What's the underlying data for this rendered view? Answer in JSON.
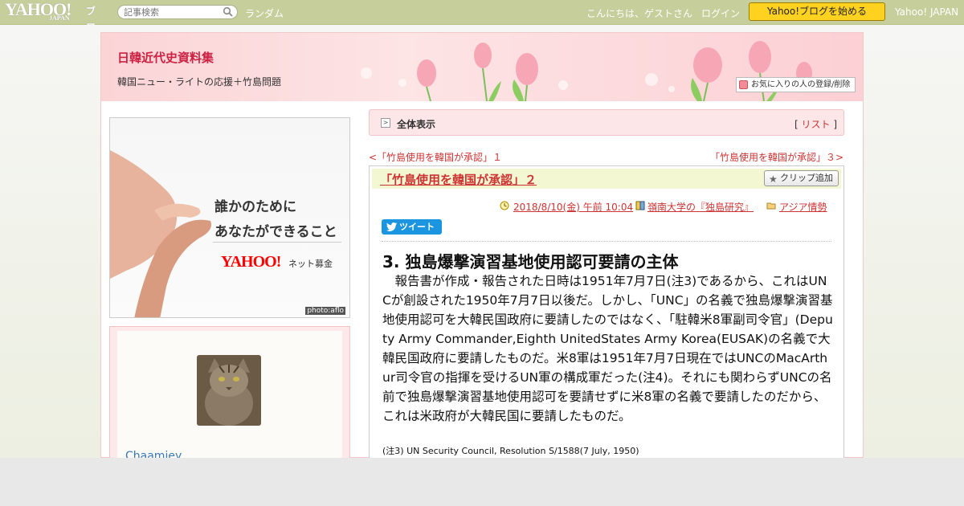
{
  "topbar": {
    "logo": "YAHOO!",
    "logo_sub": "JAPAN",
    "logo_blog": "ブログ",
    "search_placeholder": "記事検索",
    "random": "ランダム",
    "greeting": "こんにちは、ゲストさん",
    "login": "ログイン",
    "start_button": "Yahoo!ブログを始める",
    "yahoo_japan": "Yahoo! JAPAN"
  },
  "header": {
    "blog_title": "日韓近代史資料集",
    "blog_description": "韓国ニュー・ライトの応援＋竹島問題",
    "favorite_button": "お気に入りの人の登録/削除"
  },
  "sidebar": {
    "ad": {
      "line1": "誰かのために",
      "line2": "あなたができること",
      "brand": "YAHOO!",
      "brand_sub": "ネット募金",
      "credit": "photo:aflo"
    },
    "profile": {
      "username": "Chaamiey"
    }
  },
  "main": {
    "crumb_label": "全体表示",
    "crumb_list_open": "[ ",
    "crumb_list": "リスト",
    "crumb_list_close": " ]",
    "prev_link": "<「竹島使用を韓国が承認」１",
    "next_link": "「竹島使用を韓国が承認」３>",
    "article": {
      "title": "「竹島使用を韓国が承認」２",
      "clip_button": "クリップ追加",
      "date": "2018/8/10(金) 午前 10:04",
      "book": "嶺南大学の『独島研究』",
      "category": "アジア情勢",
      "tweet": "ツイート",
      "heading": "3. 独島爆撃演習基地使用認可要請の主体",
      "body": "　報告書が作成・報告された日時は1951年7月7日(注3)であるから、これはUNCが創設された1950年7月7日以後だ。しかし、「UNC」の名義で独島爆撃演習基地使用認可を大韓民国政府に要請したのではなく、「駐韓米8軍副司令官」(Deputy Army Commander,Eighth UnitedStates Army Korea(EUSAK)の名義で大韓民国政府に要請したものだ。米8軍は1951年7月7日現在ではUNCのMacArthur司令官の指揮を受けるUN軍の構成軍だった(注4)。それにも関わらずUNCの名前で独島爆撃演習基地使用認可を要請せずに米8軍の名義で要請したのだから、これは米政府が大韓民国に要請したものだ。",
      "note": "(注3) UN Security Council, Resolution S/1588(7 July, 1950)"
    }
  },
  "colors": {
    "topbar": "#c6cf9b",
    "accent_link": "#cc3333",
    "start_button": "#ffd21f",
    "header_pink": "#fbd4d6",
    "title_bar": "#f3f8d2",
    "tweet": "#1b95e0"
  }
}
